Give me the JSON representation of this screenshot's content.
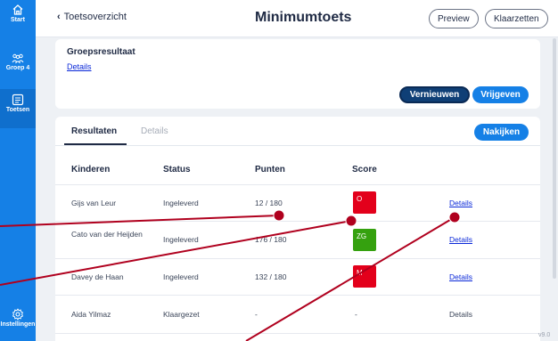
{
  "sidebar": {
    "items": [
      {
        "label": "Start",
        "icon": "home-icon",
        "active": false
      },
      {
        "label": "Groep 4",
        "icon": "group-icon",
        "active": false
      },
      {
        "label": "Toetsen",
        "icon": "tests-icon",
        "active": true
      },
      {
        "label": "Instellingen",
        "icon": "gear-icon",
        "active": false
      }
    ]
  },
  "header": {
    "back_label": "Toetsoverzicht",
    "title": "Minimumtoets",
    "preview_label": "Preview",
    "klaarzetten_label": "Klaarzetten"
  },
  "group_card": {
    "heading": "Groepsresultaat",
    "details_link": "Details",
    "vernieuwen_label": "Vernieuwen",
    "vrijgeven_label": "Vrijgeven"
  },
  "results": {
    "tabs": [
      "Resultaten",
      "Details"
    ],
    "active_tab": "Resultaten",
    "nakijken_label": "Nakijken",
    "columns": [
      "Kinderen",
      "Status",
      "Punten",
      "Score"
    ],
    "rows": [
      {
        "name": "Gijs van Leur",
        "status": "Ingeleverd",
        "points": "12 / 180",
        "score": "O",
        "score_color": "#e3001b",
        "details": "Details",
        "details_linked": true
      },
      {
        "name": "Cato van der Heijden",
        "status": "Ingeleverd",
        "points": "176 / 180",
        "score": "ZG",
        "score_color": "#35a10f",
        "details": "Details",
        "details_linked": true
      },
      {
        "name": "Davey de Haan",
        "status": "Ingeleverd",
        "points": "132 / 180",
        "score": "M",
        "score_color": "#e3001b",
        "details": "Details",
        "details_linked": true
      },
      {
        "name": "Aida Yilmaz",
        "status": "Klaargezet",
        "points": "-",
        "score": "-",
        "score_color": null,
        "details": "Details",
        "details_linked": false
      }
    ]
  },
  "version": "v9.0",
  "colors": {
    "sidebar": "#1580e6",
    "primary_button": "#1580e6",
    "dark_button": "#0f3f76",
    "link": "#0a28d8",
    "score_fail": "#e3001b",
    "score_good": "#35a10f",
    "annotation": "#b0001e"
  }
}
